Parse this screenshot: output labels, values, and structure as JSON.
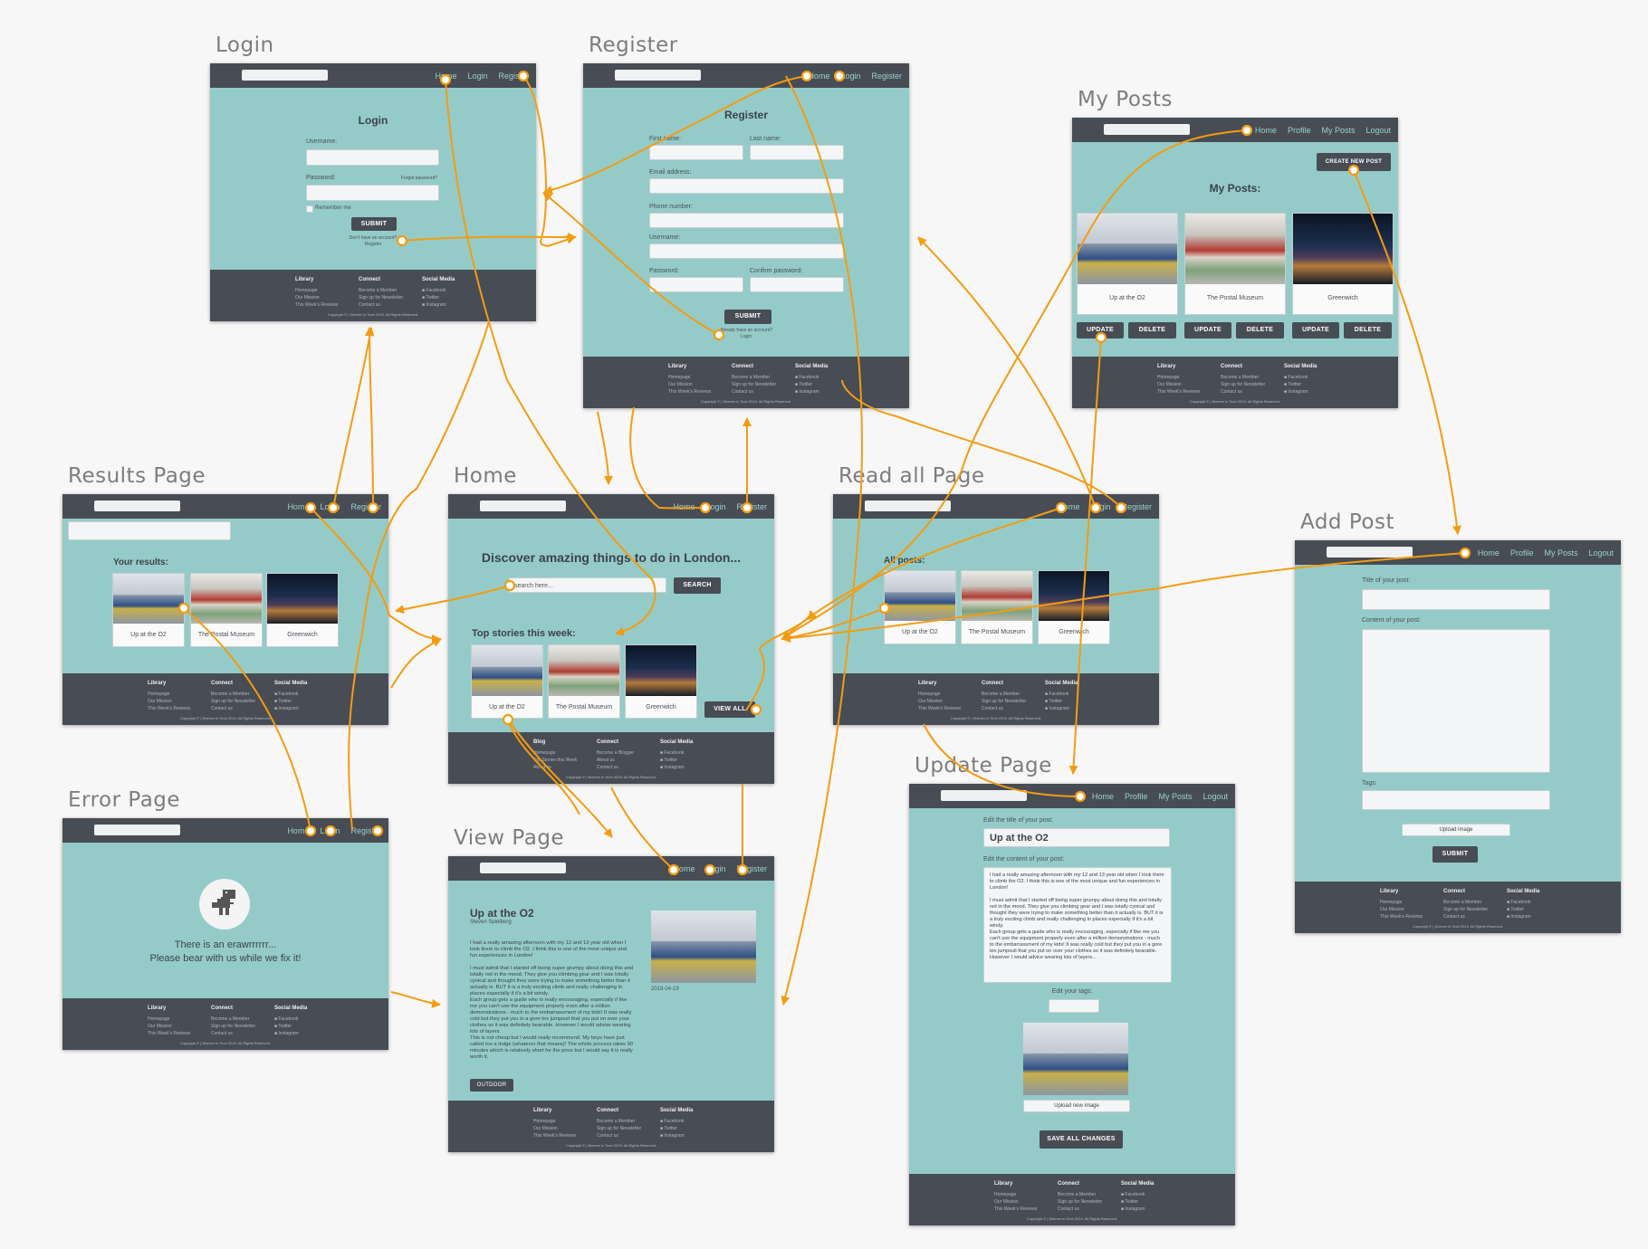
{
  "titles": {
    "login": "Login",
    "register": "Register",
    "my_posts": "My Posts",
    "results": "Results Page",
    "home": "Home",
    "read_all": "Read all Page",
    "add_post": "Add Post",
    "update": "Update Page",
    "error": "Error Page",
    "view": "View Page"
  },
  "nav": {
    "home": "Home",
    "login": "Login",
    "register": "Register",
    "profile": "Profile",
    "my_posts": "My Posts",
    "logout": "Logout"
  },
  "footer": {
    "library": "Library",
    "blog": "Blog",
    "connect": "Connect",
    "social": "Social Media",
    "homepage": "Homepage",
    "our_mission": "Our Mission",
    "weeks_reviews": "This Week's Reviews",
    "top_stories": "Top Stories this Week",
    "about_us": "About us",
    "become_member": "Become a Member",
    "become_blogger": "Become a Blogger",
    "signup": "Sign up for Newsletter",
    "contact": "Contact us",
    "facebook": "Facebook",
    "twitter": "Twitter",
    "instagram": "Instagram",
    "copyright": "Copyright © | Women in Tech 2019. All Rights Reserved."
  },
  "login": {
    "heading": "Login",
    "username": "Username:",
    "password": "Password:",
    "forgot": "Forgot password?",
    "remember": "Remember me",
    "submit": "SUBMIT",
    "no_account": "Don't have an account?",
    "register": "Register"
  },
  "register": {
    "heading": "Register",
    "first_name": "First name:",
    "last_name": "Last name:",
    "email": "Email address:",
    "phone": "Phone number:",
    "username": "Username:",
    "password": "Password:",
    "confirm": "Confirm password:",
    "submit": "SUBMIT",
    "have_account": "Already have an account?",
    "login": "Login"
  },
  "my_posts": {
    "create": "CREATE NEW POST",
    "heading": "My Posts:",
    "update": "UPDATE",
    "delete": "DELETE"
  },
  "posts": {
    "o2": "Up at the O2",
    "postal": "The Postal Museum",
    "greenwich": "Greenwich"
  },
  "results": {
    "heading": "Your results:"
  },
  "home": {
    "headline": "Discover amazing things to do in London...",
    "search_placeholder": "search here...",
    "search": "SEARCH",
    "top": "Top stories this week:",
    "view_all": "VIEW ALL"
  },
  "read_all": {
    "heading": "All posts:"
  },
  "add_post": {
    "title": "Title of your post:",
    "content": "Content of your post:",
    "tags": "Tags:",
    "upload": "Upload image",
    "submit": "SUBMIT"
  },
  "update": {
    "edit_title": "Edit the title of your post:",
    "title_value": "Up at the O2",
    "edit_content": "Edit the content of your post:",
    "content": "I had a really amazing afternoon with my 12 and 13 year old when I took them to climb the O2. I think this is one of the most unique and fun experiences in London!\n\nI must admit that I started off being super grumpy about doing this and totally not in the mood. They give you climbing gear and I was totally cynical and thought they were trying to make something better than it actually is. BUT it is a truly exciting climb and really challenging in places especially if it's a bit windy.\nEach group gets a guide who is really encouraging, especially if like me you can't use the equipment properly even after a million demonstrations - much to the embarrassment of my kids! It was really cold but they put you in a gore tex jumpsuit that you put on over your clothes so it was definitely bearable. However I would advice wearing lots of layers...",
    "edit_tags": "Edit your tags:",
    "upload_new": "Upload new image",
    "save": "SAVE ALL CHANGES"
  },
  "error": {
    "line1": "There is an erawrrrrrr...",
    "line2": "Please bear with us while we fix it!"
  },
  "view": {
    "title": "Up at the O2",
    "author": "Steven Spielberg",
    "body": "I had a really amazing afternoon with my 12 and 13 year old when I took them to climb the O2. I think this is one of the most unique and fun experiences in London!\n\nI must admit that I started off being super grumpy about doing this and totally not in the mood. They give you climbing gear and I was totally cynical and thought they were trying to make something better than it actually is. BUT it is a truly exciting climb and really challenging in places especially if it's a bit windy.\nEach group gets a guide who is really encouraging, especially if like me you can't use the equipment properly even after a million demonstrations - much to the embarrassment of my kids! It was really cold but they put you in a gore tex jumpsuit that you put on over your clothes so it was definitely bearable. However I would advise wearing lots of layers.\nThis is not cheap but I would really recommend. My boys have just called me a ledge (whatever that means)! The whole process takes 90 minutes which is relatively short for the price but I would say it is really worth it.",
    "date": "2019-04-19",
    "tag": "OUTDOOR"
  },
  "colors": {
    "canvas": "#f7f7f7",
    "screen_bg": "#94cbc8",
    "bar": "#474c55",
    "nav_link": "#9ad2cf",
    "arrow": "#f39c12"
  }
}
